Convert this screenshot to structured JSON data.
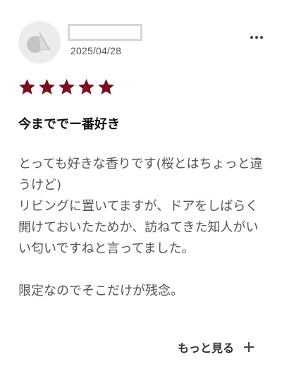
{
  "review": {
    "date": "2025/04/28",
    "rating": 5,
    "rating_max": 5,
    "title": "今まででー番好き",
    "body": "とっても好きな香りです(桜とはちょっと違うけど)\nリビングに置いてますが、ドアをしばらく開けておいたためか、訪ねてきた知人がいい匂いですねと言ってました。\n\n限定なのでそこだけが残念。",
    "read_more_label": "もっと見る"
  },
  "colors": {
    "star": "#7a0f22",
    "avatar_bg": "#ececec",
    "avatar_icon": "#c4c4c4"
  },
  "icons": {
    "avatar": "user-avatar-icon",
    "menu": "more-dots-icon",
    "star": "star-icon",
    "expand": "plus-icon"
  }
}
